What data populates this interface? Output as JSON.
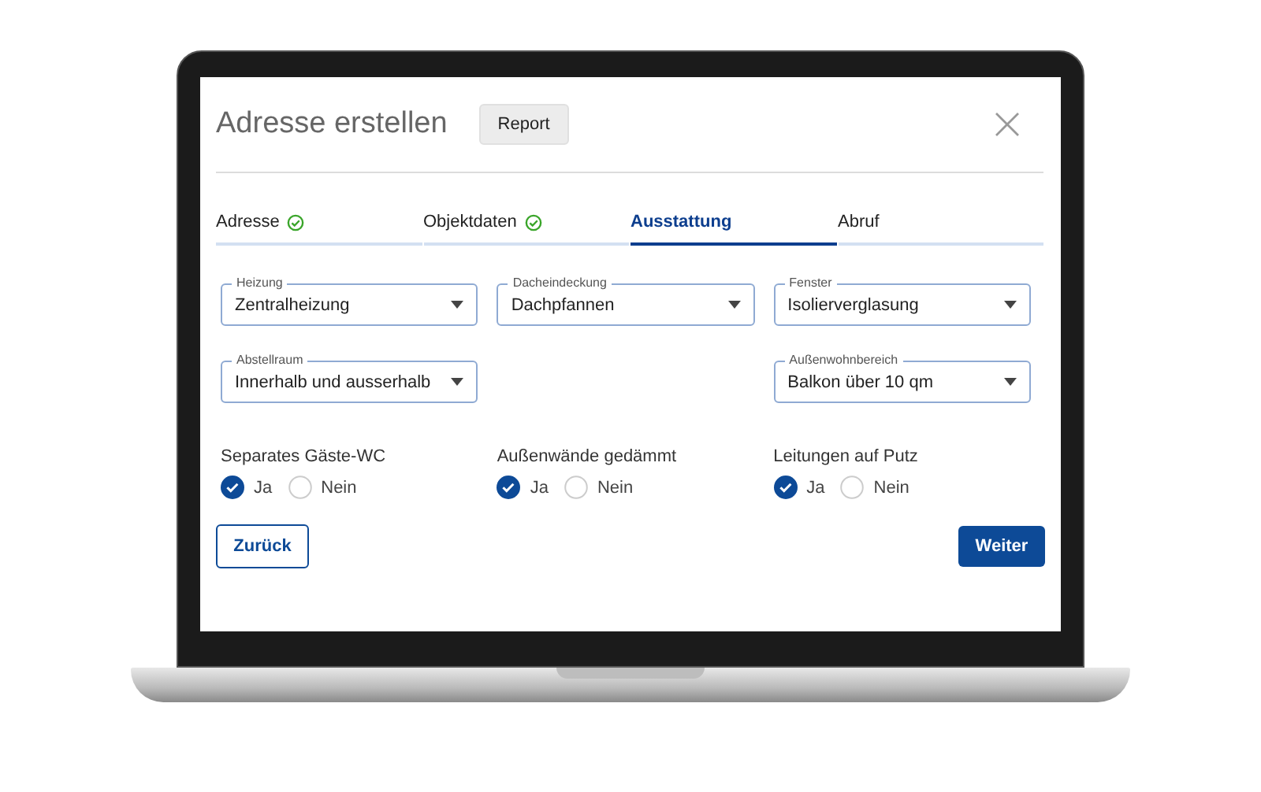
{
  "dialog": {
    "title": "Adresse erstellen",
    "report_button": "Report"
  },
  "tabs": [
    {
      "label": "Adresse",
      "done": true,
      "selected": false
    },
    {
      "label": "Objektdaten",
      "done": true,
      "selected": false
    },
    {
      "label": "Ausstattung",
      "done": false,
      "selected": true
    },
    {
      "label": "Abruf",
      "done": false,
      "selected": false
    }
  ],
  "field_rows": [
    [
      {
        "label": "Heizung",
        "value": "Zentralheizung"
      },
      {
        "label": "Dacheindeckung",
        "value": "Dachpfannen"
      },
      {
        "label": "Fenster",
        "value": "Isolierverglasung"
      }
    ],
    [
      {
        "label": "Abstellraum",
        "value": "Innerhalb und ausserhalb"
      },
      null,
      {
        "label": "Außenwohnbereich",
        "value": "Balkon über 10 qm"
      }
    ]
  ],
  "radio_groups": [
    {
      "label": "Separates Gäste-WC",
      "options": [
        {
          "label": "Ja",
          "selected": true
        },
        {
          "label": "Nein",
          "selected": false
        }
      ]
    },
    {
      "label": "Außenwände gedämmt",
      "options": [
        {
          "label": "Ja",
          "selected": true
        },
        {
          "label": "Nein",
          "selected": false
        }
      ]
    },
    {
      "label": "Leitungen auf Putz",
      "options": [
        {
          "label": "Ja",
          "selected": true
        },
        {
          "label": "Nein",
          "selected": false
        }
      ]
    }
  ],
  "buttons": {
    "back": "Zurück",
    "next": "Weiter"
  }
}
